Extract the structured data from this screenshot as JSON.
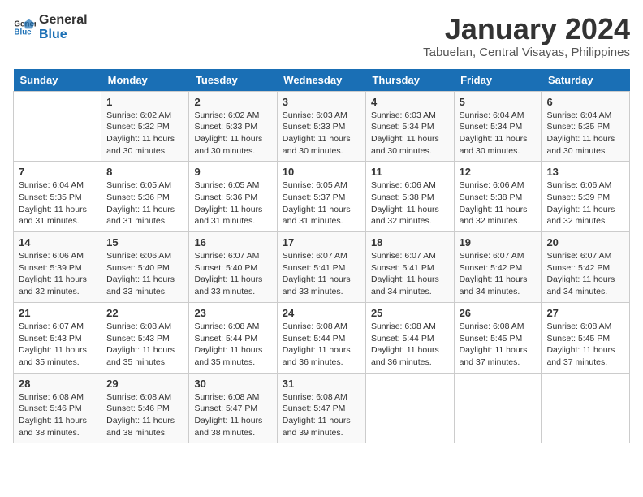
{
  "header": {
    "logo_line1": "General",
    "logo_line2": "Blue",
    "title": "January 2024",
    "subtitle": "Tabuelan, Central Visayas, Philippines"
  },
  "days_of_week": [
    "Sunday",
    "Monday",
    "Tuesday",
    "Wednesday",
    "Thursday",
    "Friday",
    "Saturday"
  ],
  "weeks": [
    [
      {
        "day": "",
        "sunrise": "",
        "sunset": "",
        "daylight": ""
      },
      {
        "day": "1",
        "sunrise": "Sunrise: 6:02 AM",
        "sunset": "Sunset: 5:32 PM",
        "daylight": "Daylight: 11 hours and 30 minutes."
      },
      {
        "day": "2",
        "sunrise": "Sunrise: 6:02 AM",
        "sunset": "Sunset: 5:33 PM",
        "daylight": "Daylight: 11 hours and 30 minutes."
      },
      {
        "day": "3",
        "sunrise": "Sunrise: 6:03 AM",
        "sunset": "Sunset: 5:33 PM",
        "daylight": "Daylight: 11 hours and 30 minutes."
      },
      {
        "day": "4",
        "sunrise": "Sunrise: 6:03 AM",
        "sunset": "Sunset: 5:34 PM",
        "daylight": "Daylight: 11 hours and 30 minutes."
      },
      {
        "day": "5",
        "sunrise": "Sunrise: 6:04 AM",
        "sunset": "Sunset: 5:34 PM",
        "daylight": "Daylight: 11 hours and 30 minutes."
      },
      {
        "day": "6",
        "sunrise": "Sunrise: 6:04 AM",
        "sunset": "Sunset: 5:35 PM",
        "daylight": "Daylight: 11 hours and 30 minutes."
      }
    ],
    [
      {
        "day": "7",
        "sunrise": "Sunrise: 6:04 AM",
        "sunset": "Sunset: 5:35 PM",
        "daylight": "Daylight: 11 hours and 31 minutes."
      },
      {
        "day": "8",
        "sunrise": "Sunrise: 6:05 AM",
        "sunset": "Sunset: 5:36 PM",
        "daylight": "Daylight: 11 hours and 31 minutes."
      },
      {
        "day": "9",
        "sunrise": "Sunrise: 6:05 AM",
        "sunset": "Sunset: 5:36 PM",
        "daylight": "Daylight: 11 hours and 31 minutes."
      },
      {
        "day": "10",
        "sunrise": "Sunrise: 6:05 AM",
        "sunset": "Sunset: 5:37 PM",
        "daylight": "Daylight: 11 hours and 31 minutes."
      },
      {
        "day": "11",
        "sunrise": "Sunrise: 6:06 AM",
        "sunset": "Sunset: 5:38 PM",
        "daylight": "Daylight: 11 hours and 32 minutes."
      },
      {
        "day": "12",
        "sunrise": "Sunrise: 6:06 AM",
        "sunset": "Sunset: 5:38 PM",
        "daylight": "Daylight: 11 hours and 32 minutes."
      },
      {
        "day": "13",
        "sunrise": "Sunrise: 6:06 AM",
        "sunset": "Sunset: 5:39 PM",
        "daylight": "Daylight: 11 hours and 32 minutes."
      }
    ],
    [
      {
        "day": "14",
        "sunrise": "Sunrise: 6:06 AM",
        "sunset": "Sunset: 5:39 PM",
        "daylight": "Daylight: 11 hours and 32 minutes."
      },
      {
        "day": "15",
        "sunrise": "Sunrise: 6:06 AM",
        "sunset": "Sunset: 5:40 PM",
        "daylight": "Daylight: 11 hours and 33 minutes."
      },
      {
        "day": "16",
        "sunrise": "Sunrise: 6:07 AM",
        "sunset": "Sunset: 5:40 PM",
        "daylight": "Daylight: 11 hours and 33 minutes."
      },
      {
        "day": "17",
        "sunrise": "Sunrise: 6:07 AM",
        "sunset": "Sunset: 5:41 PM",
        "daylight": "Daylight: 11 hours and 33 minutes."
      },
      {
        "day": "18",
        "sunrise": "Sunrise: 6:07 AM",
        "sunset": "Sunset: 5:41 PM",
        "daylight": "Daylight: 11 hours and 34 minutes."
      },
      {
        "day": "19",
        "sunrise": "Sunrise: 6:07 AM",
        "sunset": "Sunset: 5:42 PM",
        "daylight": "Daylight: 11 hours and 34 minutes."
      },
      {
        "day": "20",
        "sunrise": "Sunrise: 6:07 AM",
        "sunset": "Sunset: 5:42 PM",
        "daylight": "Daylight: 11 hours and 34 minutes."
      }
    ],
    [
      {
        "day": "21",
        "sunrise": "Sunrise: 6:07 AM",
        "sunset": "Sunset: 5:43 PM",
        "daylight": "Daylight: 11 hours and 35 minutes."
      },
      {
        "day": "22",
        "sunrise": "Sunrise: 6:08 AM",
        "sunset": "Sunset: 5:43 PM",
        "daylight": "Daylight: 11 hours and 35 minutes."
      },
      {
        "day": "23",
        "sunrise": "Sunrise: 6:08 AM",
        "sunset": "Sunset: 5:44 PM",
        "daylight": "Daylight: 11 hours and 35 minutes."
      },
      {
        "day": "24",
        "sunrise": "Sunrise: 6:08 AM",
        "sunset": "Sunset: 5:44 PM",
        "daylight": "Daylight: 11 hours and 36 minutes."
      },
      {
        "day": "25",
        "sunrise": "Sunrise: 6:08 AM",
        "sunset": "Sunset: 5:44 PM",
        "daylight": "Daylight: 11 hours and 36 minutes."
      },
      {
        "day": "26",
        "sunrise": "Sunrise: 6:08 AM",
        "sunset": "Sunset: 5:45 PM",
        "daylight": "Daylight: 11 hours and 37 minutes."
      },
      {
        "day": "27",
        "sunrise": "Sunrise: 6:08 AM",
        "sunset": "Sunset: 5:45 PM",
        "daylight": "Daylight: 11 hours and 37 minutes."
      }
    ],
    [
      {
        "day": "28",
        "sunrise": "Sunrise: 6:08 AM",
        "sunset": "Sunset: 5:46 PM",
        "daylight": "Daylight: 11 hours and 38 minutes."
      },
      {
        "day": "29",
        "sunrise": "Sunrise: 6:08 AM",
        "sunset": "Sunset: 5:46 PM",
        "daylight": "Daylight: 11 hours and 38 minutes."
      },
      {
        "day": "30",
        "sunrise": "Sunrise: 6:08 AM",
        "sunset": "Sunset: 5:47 PM",
        "daylight": "Daylight: 11 hours and 38 minutes."
      },
      {
        "day": "31",
        "sunrise": "Sunrise: 6:08 AM",
        "sunset": "Sunset: 5:47 PM",
        "daylight": "Daylight: 11 hours and 39 minutes."
      },
      {
        "day": "",
        "sunrise": "",
        "sunset": "",
        "daylight": ""
      },
      {
        "day": "",
        "sunrise": "",
        "sunset": "",
        "daylight": ""
      },
      {
        "day": "",
        "sunrise": "",
        "sunset": "",
        "daylight": ""
      }
    ]
  ]
}
